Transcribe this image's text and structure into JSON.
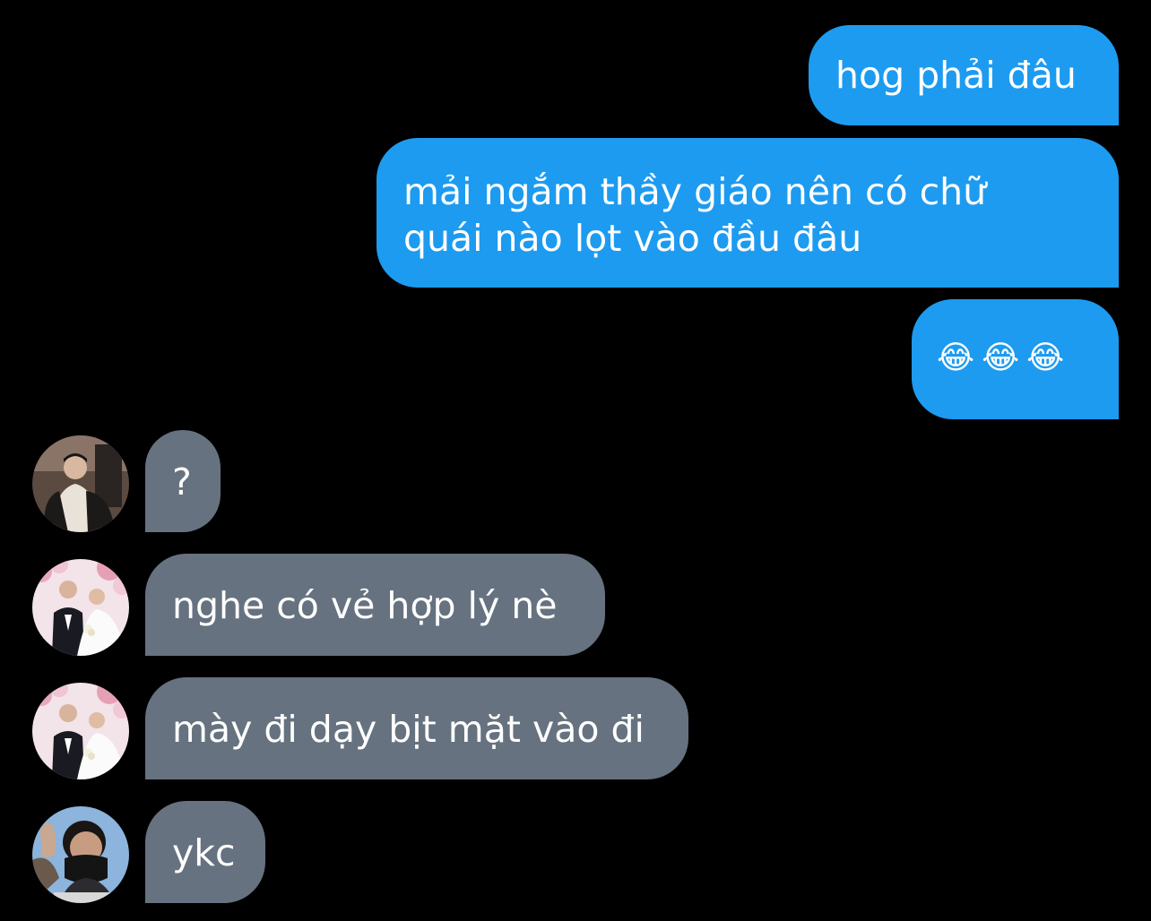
{
  "conversation": {
    "colors": {
      "background": "#000000",
      "sent_bubble": "#1d9bf0",
      "received_bubble": "#66727f",
      "text": "#ffffff"
    },
    "messages": [
      {
        "direction": "sent",
        "text": "hog phải đâu"
      },
      {
        "direction": "sent",
        "text": "mải ngắm thầy giáo nên có chữ\nquái nào lọt vào đầu đâu"
      },
      {
        "direction": "sent",
        "text": "😂😂😂"
      },
      {
        "direction": "received",
        "text": "?",
        "avatar": "person-photo-avatar"
      },
      {
        "direction": "received",
        "text": "nghe có vẻ hợp lý nè",
        "avatar": "wedding-photo-avatar"
      },
      {
        "direction": "received",
        "text": "mày đi dạy bịt mặt vào đi",
        "avatar": "wedding-photo-avatar"
      },
      {
        "direction": "received",
        "text": "ykc",
        "avatar": "masked-selfie-avatar"
      }
    ]
  }
}
